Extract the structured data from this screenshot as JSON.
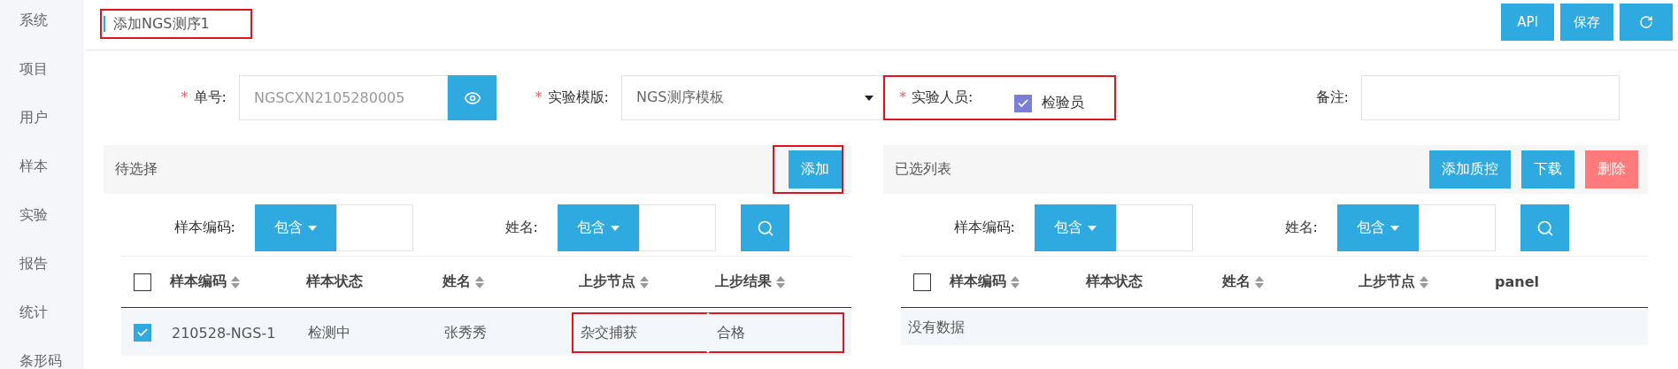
{
  "sidebar": {
    "items": [
      {
        "label": "系统"
      },
      {
        "label": "项目"
      },
      {
        "label": "用户"
      },
      {
        "label": "样本"
      },
      {
        "label": "实验"
      },
      {
        "label": "报告"
      },
      {
        "label": "统计"
      },
      {
        "label": "条形码"
      }
    ]
  },
  "header": {
    "title": "添加NGS测序1",
    "highlighted": true,
    "buttons": [
      {
        "kind": "text",
        "label": "API"
      },
      {
        "kind": "text",
        "label": "保存"
      },
      {
        "kind": "refresh"
      }
    ]
  },
  "form": {
    "order_no": {
      "required_mark": "*",
      "label": "单号:",
      "value": "NGSCXN2105280005"
    },
    "template": {
      "required_mark": "*",
      "label": "实验模版:",
      "value": "NGS测序模板"
    },
    "staff": {
      "required_mark": "*",
      "label": "实验人员:",
      "highlighted": true,
      "options": [
        {
          "label": "检验员",
          "checked": true
        }
      ]
    },
    "remark": {
      "label": "备注:"
    }
  },
  "pending": {
    "title": "待选择",
    "buttons": [
      {
        "label": "添加",
        "kind": "primary",
        "highlighted": true
      }
    ],
    "filters": [
      {
        "label": "样本编码:",
        "operator": "包含"
      },
      {
        "label": "姓名:",
        "operator": "包含"
      }
    ],
    "all_checked": false,
    "columns": [
      {
        "label": "样本编码",
        "sortable": true
      },
      {
        "label": "样本状态",
        "sortable": false
      },
      {
        "label": "姓名",
        "sortable": true
      },
      {
        "label": "上步节点",
        "sortable": true
      },
      {
        "label": "上步结果",
        "sortable": true
      }
    ],
    "rows": [
      {
        "selected": true,
        "cells": [
          {
            "text": "210528-NGS-1",
            "highlighted": false
          },
          {
            "text": "检测中",
            "highlighted": false
          },
          {
            "text": "张秀秀",
            "highlighted": false
          },
          {
            "text": "杂交捕获",
            "highlighted": true
          },
          {
            "text": "合格",
            "highlighted": true
          }
        ]
      }
    ]
  },
  "chosen": {
    "title": "已选列表",
    "buttons": [
      {
        "label": "添加质控",
        "kind": "primary",
        "highlighted": false
      },
      {
        "label": "下载",
        "kind": "primary",
        "highlighted": false
      },
      {
        "label": "删除",
        "kind": "danger",
        "highlighted": false
      }
    ],
    "filters": [
      {
        "label": "样本编码:",
        "operator": "包含"
      },
      {
        "label": "姓名:",
        "operator": "包含"
      }
    ],
    "all_checked": false,
    "columns": [
      {
        "label": "样本编码",
        "sortable": true
      },
      {
        "label": "样本状态",
        "sortable": false
      },
      {
        "label": "姓名",
        "sortable": true
      },
      {
        "label": "上步节点",
        "sortable": true
      },
      {
        "label": "panel",
        "sortable": false
      }
    ],
    "empty_text": "没有数据"
  }
}
